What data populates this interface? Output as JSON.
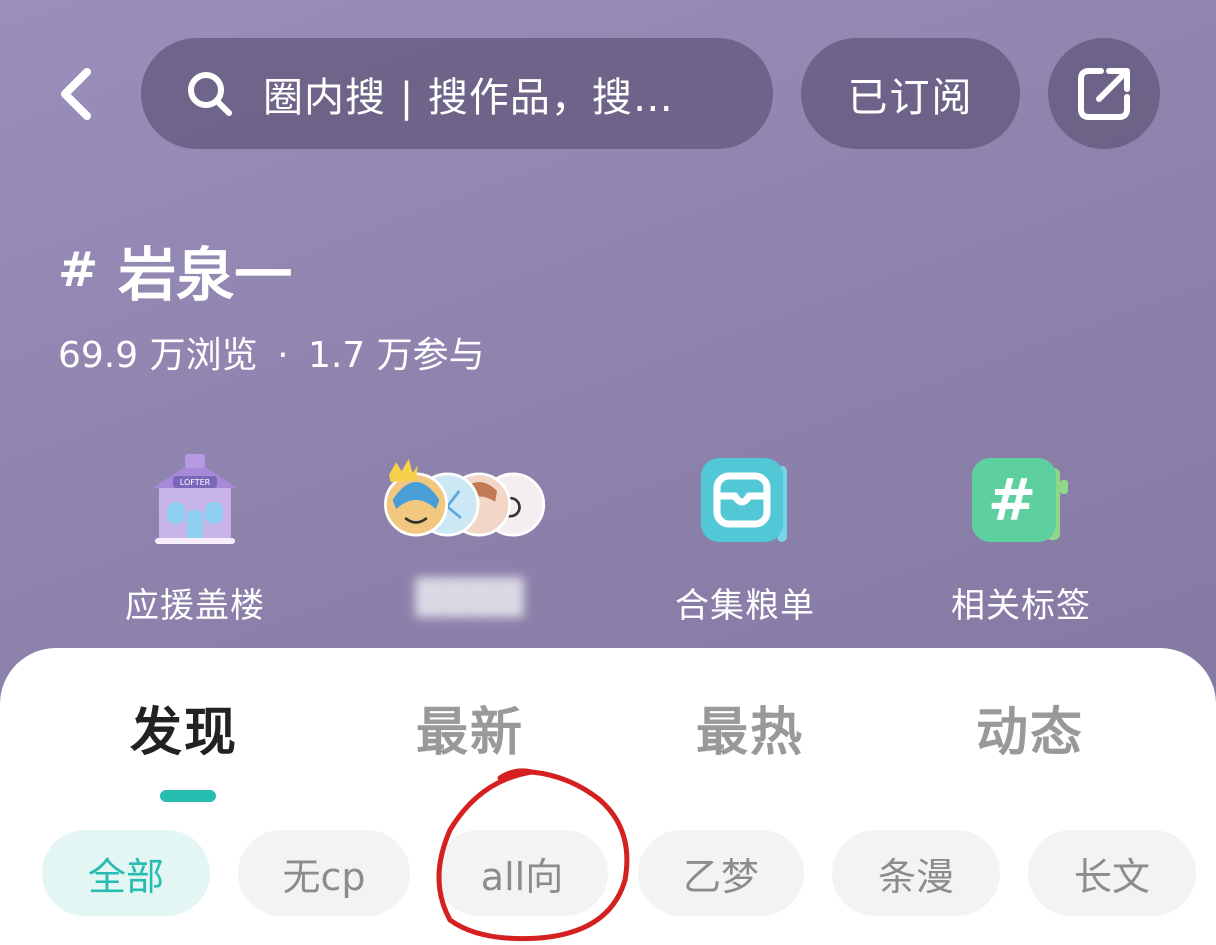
{
  "top_bar": {
    "search_placeholder": "圈内搜 | 搜作品，搜…",
    "subscribe_label": "已订阅"
  },
  "tag": {
    "hash": "#",
    "name": "岩泉一",
    "views": "69.9 万浏览",
    "separator": "·",
    "participants": "1.7 万参与"
  },
  "features": [
    {
      "label": "应援盖楼",
      "icon": "house-icon"
    },
    {
      "label": "",
      "icon": "avatar-stack-icon"
    },
    {
      "label": "合集粮单",
      "icon": "collection-icon"
    },
    {
      "label": "相关标签",
      "icon": "tag-icon"
    }
  ],
  "tabs": [
    {
      "label": "发现",
      "active": true
    },
    {
      "label": "最新",
      "active": false
    },
    {
      "label": "最热",
      "active": false
    },
    {
      "label": "动态",
      "active": false
    }
  ],
  "chips": [
    {
      "label": "全部",
      "active": true
    },
    {
      "label": "无cp",
      "active": false
    },
    {
      "label": "all向",
      "active": false
    },
    {
      "label": "乙梦",
      "active": false
    },
    {
      "label": "条漫",
      "active": false
    },
    {
      "label": "长文",
      "active": false
    }
  ],
  "colors": {
    "accent": "#26bcb0",
    "annotation": "#d42020",
    "header_bg": "#8f84ae"
  }
}
